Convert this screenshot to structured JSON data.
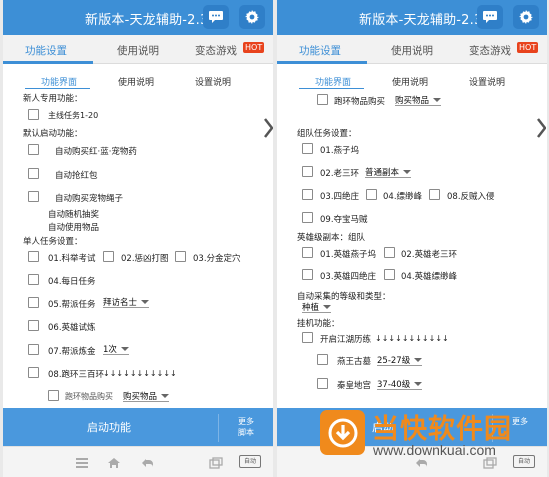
{
  "app": {
    "title": "新版本-天龙辅助-2.3",
    "accent_color": "#3d8fd6",
    "hot_color": "#e8431d"
  },
  "tabs": [
    {
      "label": "功能设置",
      "active": true
    },
    {
      "label": "使用说明",
      "active": false
    },
    {
      "label": "变态游戏",
      "active": false,
      "badge": "HOT"
    }
  ],
  "subtabs": [
    {
      "label": "功能界面",
      "active": true
    },
    {
      "label": "使用说明",
      "active": false
    },
    {
      "label": "设置说明",
      "active": false
    }
  ],
  "left": {
    "newbie_header": "新人专用功能：",
    "main_quest": "主线任务1-20",
    "default_header": "默认启动功能：",
    "auto_buy_potion": "自动购买红·蓝·宠物药",
    "auto_red_envelope": "自动抢红包",
    "auto_buy_rope": "自动购买宠物绳子",
    "auto_lottery": "自动随机抽奖",
    "auto_use_items": "自动使用物品",
    "single_header": "单人任务设置：",
    "q01": "01.科举考试",
    "q02": "02.惩凶打图",
    "q03": "03.分金定穴",
    "q04": "04.每日任务",
    "q05": "05.帮派任务",
    "q05_select": "拜访名士",
    "q06": "06.英雄试炼",
    "q07": "07.帮派炼金",
    "q07_select": "1次",
    "q08": "08.跑环三百环",
    "q08_arrows": "↓↓↓↓↓↓↓↓↓↓↓",
    "cut_left": "跑环物品购买",
    "cut_right": "购买物品",
    "start_button": "启动功能",
    "more_button": "更多\n脚本"
  },
  "right": {
    "ring_buy": "跑环物品购买",
    "ring_buy_select": "购买物品",
    "team_header": "组队任务设置：",
    "t01": "01.燕子坞",
    "t02": "02.老三环",
    "t02_select": "普通副本",
    "t03": "03.四绝庄",
    "t04": "04.缥缈峰",
    "t08": "08.反贼入侵",
    "t09": "09.夺宝马贼",
    "hero_header": "英雄级副本：组队",
    "h01": "01.英雄燕子坞",
    "h02": "02.英雄老三环",
    "h03": "03.英雄四绝庄",
    "h04": "04.英雄缥缈峰",
    "gather_header": "自动采集的等级和类型：",
    "gather_select": "种植",
    "hang_header": "挂机功能：",
    "jianghu": "开启江湖历练",
    "jianghu_arrows": "↓↓↓↓↓↓↓↓↓↓↓",
    "yanwang": "燕王古墓",
    "yanwang_select": "25-27级",
    "qinhuang": "秦皇地宫",
    "qinhuang_select": "37-40级",
    "start_partial": "启动",
    "more_partial": "更多"
  },
  "navbar": {
    "auto_label": "自动"
  },
  "watermark": {
    "name": "当快软件园",
    "url": "www.downkuai.com",
    "color": "#f08a1c"
  }
}
